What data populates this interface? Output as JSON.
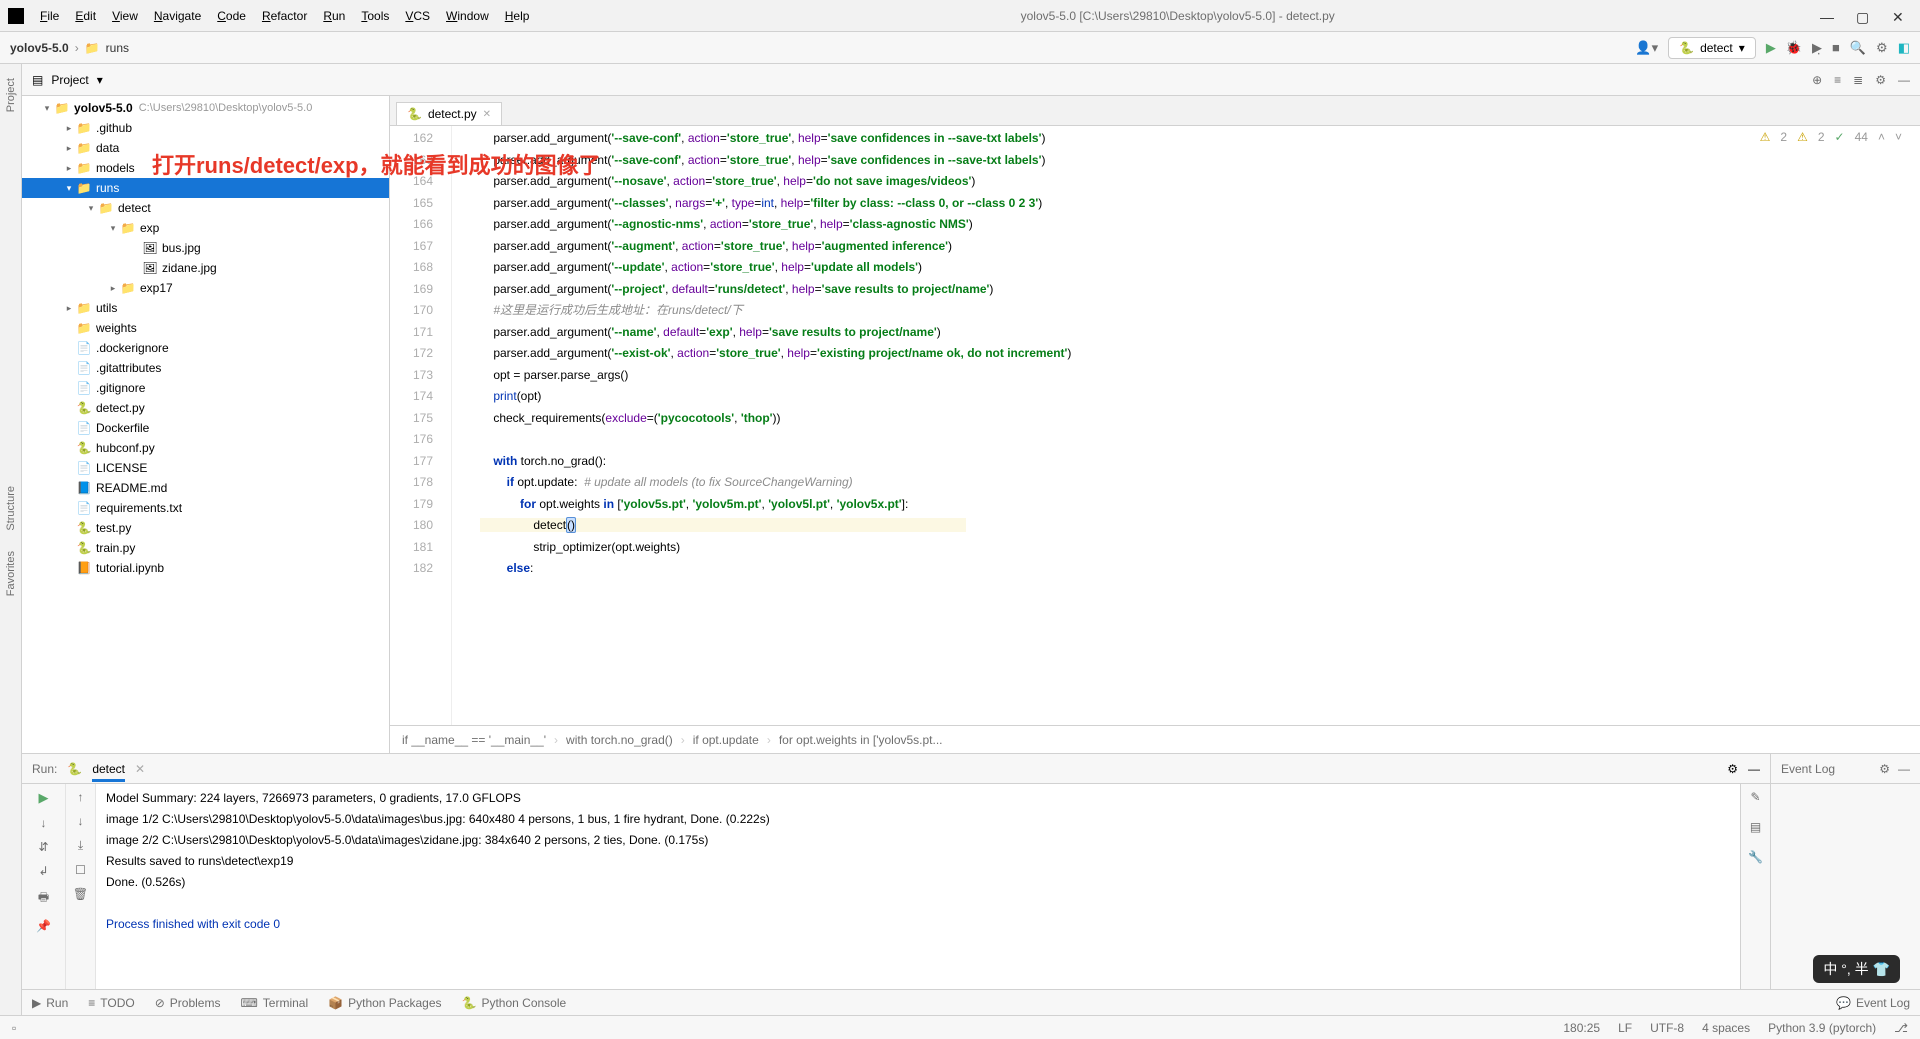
{
  "window": {
    "title": "yolov5-5.0 [C:\\Users\\29810\\Desktop\\yolov5-5.0] - detect.py",
    "min": "—",
    "max": "▢",
    "close": "✕"
  },
  "menu": [
    "File",
    "Edit",
    "View",
    "Navigate",
    "Code",
    "Refactor",
    "Run",
    "Tools",
    "VCS",
    "Window",
    "Help"
  ],
  "breadcrumb": {
    "project": "yolov5-5.0",
    "folder": "runs"
  },
  "run_config": "detect",
  "project_panel": {
    "title": "Project"
  },
  "tree": [
    {
      "indent": 1,
      "arrow": "▾",
      "ico": "📁",
      "label": "yolov5-5.0",
      "hint": "C:\\Users\\29810\\Desktop\\yolov5-5.0",
      "bold": true
    },
    {
      "indent": 2,
      "arrow": "▸",
      "ico": "📁",
      "label": ".github"
    },
    {
      "indent": 2,
      "arrow": "▸",
      "ico": "📁",
      "label": "data"
    },
    {
      "indent": 2,
      "arrow": "▸",
      "ico": "📁",
      "label": "models"
    },
    {
      "indent": 2,
      "arrow": "▾",
      "ico": "📁",
      "label": "runs",
      "sel": true
    },
    {
      "indent": 3,
      "arrow": "▾",
      "ico": "📁",
      "label": "detect"
    },
    {
      "indent": 4,
      "arrow": "▾",
      "ico": "📁",
      "label": "exp"
    },
    {
      "indent": 5,
      "arrow": "",
      "ico": "🖼",
      "label": "bus.jpg"
    },
    {
      "indent": 5,
      "arrow": "",
      "ico": "🖼",
      "label": "zidane.jpg"
    },
    {
      "indent": 4,
      "arrow": "▸",
      "ico": "📁",
      "label": "exp17"
    },
    {
      "indent": 2,
      "arrow": "▸",
      "ico": "📁",
      "label": "utils"
    },
    {
      "indent": 2,
      "arrow": "",
      "ico": "📁",
      "label": "weights"
    },
    {
      "indent": 2,
      "arrow": "",
      "ico": "📄",
      "label": ".dockerignore"
    },
    {
      "indent": 2,
      "arrow": "",
      "ico": "📄",
      "label": ".gitattributes"
    },
    {
      "indent": 2,
      "arrow": "",
      "ico": "📄",
      "label": ".gitignore"
    },
    {
      "indent": 2,
      "arrow": "",
      "ico": "🐍",
      "label": "detect.py"
    },
    {
      "indent": 2,
      "arrow": "",
      "ico": "📄",
      "label": "Dockerfile"
    },
    {
      "indent": 2,
      "arrow": "",
      "ico": "🐍",
      "label": "hubconf.py"
    },
    {
      "indent": 2,
      "arrow": "",
      "ico": "📄",
      "label": "LICENSE"
    },
    {
      "indent": 2,
      "arrow": "",
      "ico": "📘",
      "label": "README.md"
    },
    {
      "indent": 2,
      "arrow": "",
      "ico": "📄",
      "label": "requirements.txt"
    },
    {
      "indent": 2,
      "arrow": "",
      "ico": "🐍",
      "label": "test.py"
    },
    {
      "indent": 2,
      "arrow": "",
      "ico": "🐍",
      "label": "train.py"
    },
    {
      "indent": 2,
      "arrow": "",
      "ico": "📙",
      "label": "tutorial.ipynb"
    }
  ],
  "tab": {
    "name": "detect.py"
  },
  "inspections": {
    "warn1": "2",
    "warn2": "2",
    "ok": "44"
  },
  "gutter_start": 162,
  "code_lines": [
    {
      "n": 162,
      "html": "    parser.add_argument(<span class='str'>'--save-conf'</span>, <span class='arg'>action</span>=<span class='str'>'store_true'</span>, <span class='arg'>help</span>=<span class='str'>'save confidences in --save-txt labels'</span>)"
    },
    {
      "n": 163,
      "html": "    parser.add_argument(<span class='str'>'--save-conf'</span>, <span class='arg'>action</span>=<span class='str'>'store_true'</span>, <span class='arg'>help</span>=<span class='str'>'save confidences in --save-txt labels'</span>)"
    },
    {
      "n": 164,
      "html": "    parser.add_argument(<span class='str'>'--nosave'</span>, <span class='arg'>action</span>=<span class='str'>'store_true'</span>, <span class='arg'>help</span>=<span class='str'>'do not save images/videos'</span>)"
    },
    {
      "n": 165,
      "html": "    parser.add_argument(<span class='str'>'--classes'</span>, <span class='arg'>nargs</span>=<span class='str'>'+'</span>, <span class='arg'>type</span>=<span class='builtin'>int</span>, <span class='arg'>help</span>=<span class='str'>'filter by class: --class 0, or --class 0 2 3'</span>)"
    },
    {
      "n": 166,
      "html": "    parser.add_argument(<span class='str'>'--agnostic-nms'</span>, <span class='arg'>action</span>=<span class='str'>'store_true'</span>, <span class='arg'>help</span>=<span class='str'>'class-agnostic NMS'</span>)"
    },
    {
      "n": 167,
      "html": "    parser.add_argument(<span class='str'>'--augment'</span>, <span class='arg'>action</span>=<span class='str'>'store_true'</span>, <span class='arg'>help</span>=<span class='str'>'augmented inference'</span>)"
    },
    {
      "n": 168,
      "html": "    parser.add_argument(<span class='str'>'--update'</span>, <span class='arg'>action</span>=<span class='str'>'store_true'</span>, <span class='arg'>help</span>=<span class='str'>'update all models'</span>)"
    },
    {
      "n": 169,
      "html": "    parser.add_argument(<span class='str'>'--project'</span>, <span class='arg'>default</span>=<span class='str'>'runs/detect'</span>, <span class='arg'>help</span>=<span class='str'>'save results to project/name'</span>)"
    },
    {
      "n": 170,
      "html": "    <span class='cm'>#这里是运行成功后生成地址：在runs/detect/下</span>"
    },
    {
      "n": 171,
      "html": "    parser.add_argument(<span class='str'>'--name'</span>, <span class='arg'>default</span>=<span class='str'>'exp'</span>, <span class='arg'>help</span>=<span class='str'>'save results to project/name'</span>)"
    },
    {
      "n": 172,
      "html": "    parser.add_argument(<span class='str'>'--exist-ok'</span>, <span class='arg'>action</span>=<span class='str'>'store_true'</span>, <span class='arg'>help</span>=<span class='str'>'existing project/name ok, do not increment'</span>)"
    },
    {
      "n": 173,
      "html": "    opt = parser.parse_args()"
    },
    {
      "n": 174,
      "html": "    <span class='builtin'>print</span>(opt)"
    },
    {
      "n": 175,
      "html": "    check_requirements(<span class='arg'>exclude</span>=(<span class='str'>'pycocotools'</span>, <span class='str'>'thop'</span>))"
    },
    {
      "n": 176,
      "html": ""
    },
    {
      "n": 177,
      "html": "    <span class='kw'>with</span> torch.no_grad():"
    },
    {
      "n": 178,
      "html": "        <span class='kw'>if</span> opt.update:  <span class='cm'># update all models (to fix SourceChangeWarning)</span>"
    },
    {
      "n": 179,
      "html": "            <span class='kw'>for</span> opt.weights <span class='kw'>in</span> [<span class='str'>'yolov5s.pt'</span>, <span class='str'>'yolov5m.pt'</span>, <span class='str'>'yolov5l.pt'</span>, <span class='str'>'yolov5x.pt'</span>]:"
    },
    {
      "n": 180,
      "html": "<span class='hl'>                detect<span class='caret'>()</span>                                                                                                                     </span>"
    },
    {
      "n": 181,
      "html": "                strip_optimizer(opt.weights)"
    },
    {
      "n": 182,
      "html": "        <span class='kw'>else</span>:"
    }
  ],
  "crumbs": [
    "if __name__ == '__main__'",
    "with torch.no_grad()",
    "if opt.update",
    "for opt.weights in ['yolov5s.pt..."
  ],
  "run": {
    "title": "Run:",
    "tab": "detect",
    "lines": [
      {
        "cls": "d",
        "t": "Model Summary: 224 layers, 7266973 parameters, 0 gradients, 17.0 GFLOPS"
      },
      {
        "cls": "d",
        "t": "image 1/2 C:\\Users\\29810\\Desktop\\yolov5-5.0\\data\\images\\bus.jpg: 640x480 4 persons, 1 bus, 1 fire hydrant, Done. (0.222s)"
      },
      {
        "cls": "d",
        "t": "image 2/2 C:\\Users\\29810\\Desktop\\yolov5-5.0\\data\\images\\zidane.jpg: 384x640 2 persons, 2 ties, Done. (0.175s)"
      },
      {
        "cls": "d",
        "t": "Results saved to runs\\detect\\exp19"
      },
      {
        "cls": "d",
        "t": "Done. (0.526s)"
      },
      {
        "cls": "d",
        "t": ""
      },
      {
        "cls": "b",
        "t": "Process finished with exit code 0"
      }
    ]
  },
  "event_log": "Event Log",
  "footer_tools": [
    "Run",
    "TODO",
    "Problems",
    "Terminal",
    "Python Packages",
    "Python Console"
  ],
  "footer_right": "Event Log",
  "status": {
    "pos": "180:25",
    "eol": "LF",
    "enc": "UTF-8",
    "indent": "4 spaces",
    "interp": "Python 3.9 (pytorch)",
    "branch": "⎇"
  },
  "annotation": "打开runs/detect/exp，就能看到成功的图像了",
  "ime": "中 °, 半 👕"
}
